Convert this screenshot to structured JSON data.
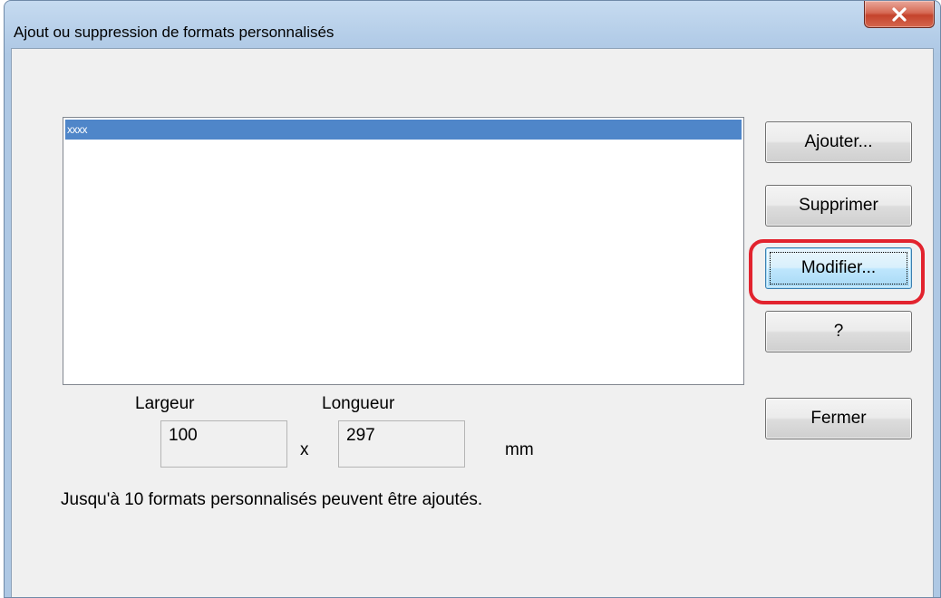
{
  "window": {
    "title": "Ajout ou suppression de formats personnalisés",
    "close_icon": "close-icon"
  },
  "list": {
    "items": [
      {
        "label": "xxxx",
        "selected": true
      }
    ]
  },
  "buttons": {
    "add": "Ajouter...",
    "delete": "Supprimer",
    "modify": "Modifier...",
    "help": "?",
    "close": "Fermer"
  },
  "dimensions": {
    "width_label": "Largeur",
    "length_label": "Longueur",
    "width_value": "100",
    "length_value": "297",
    "separator": "x",
    "unit": "mm"
  },
  "info_text": "Jusqu'à 10 formats personnalisés peuvent être ajoutés.",
  "colors": {
    "selection": "#4f86c9",
    "highlight": "#e2232e",
    "close_button": "#c4432c"
  }
}
